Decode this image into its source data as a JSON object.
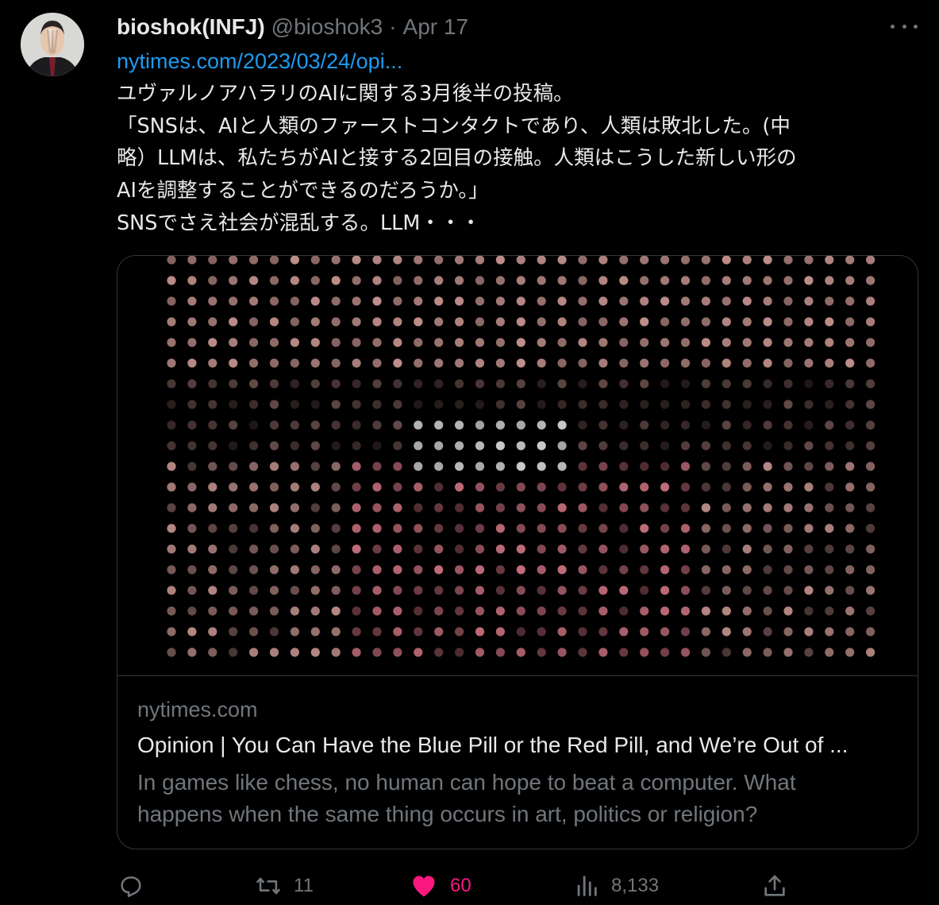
{
  "tweet": {
    "display_name": "bioshok(INFJ)",
    "handle": "@bioshok3",
    "separator": "·",
    "date": "Apr 17",
    "link_text": "nytimes.com/2023/03/24/opi...",
    "text_lines": [
      "ユヴァルノアハラリのAIに関する3月後半の投稿。",
      "「SNSは、AIと人類のファーストコンタクトであり、人類は敗北した。(中",
      "略）LLMは、私たちがAIと接する2回目の接触。人類はこうした新しい形の",
      "AIを調整することができるのだろうか。」",
      "SNSでさえ社会が混乱する。LLM・・・"
    ]
  },
  "card": {
    "domain": "nytimes.com",
    "title": "Opinion | You Can Have the Blue Pill or the Red Pill, and We’re Out of ...",
    "description": "In games like chess, no human can hope to beat a computer. What happens when the same thing occurs in art, politics or religion?"
  },
  "actions": {
    "reply": {
      "icon": "reply-icon",
      "count": ""
    },
    "retweet": {
      "icon": "retweet-icon",
      "count": "11"
    },
    "like": {
      "icon": "heart-icon",
      "count": "60",
      "liked": true
    },
    "views": {
      "icon": "analytics-icon",
      "count": "8,133"
    },
    "share": {
      "icon": "share-icon"
    }
  },
  "colors": {
    "background": "#000000",
    "text": "#e7e9ea",
    "muted": "#71767b",
    "link": "#1d9bf0",
    "like": "#f91880",
    "border": "#333639"
  }
}
